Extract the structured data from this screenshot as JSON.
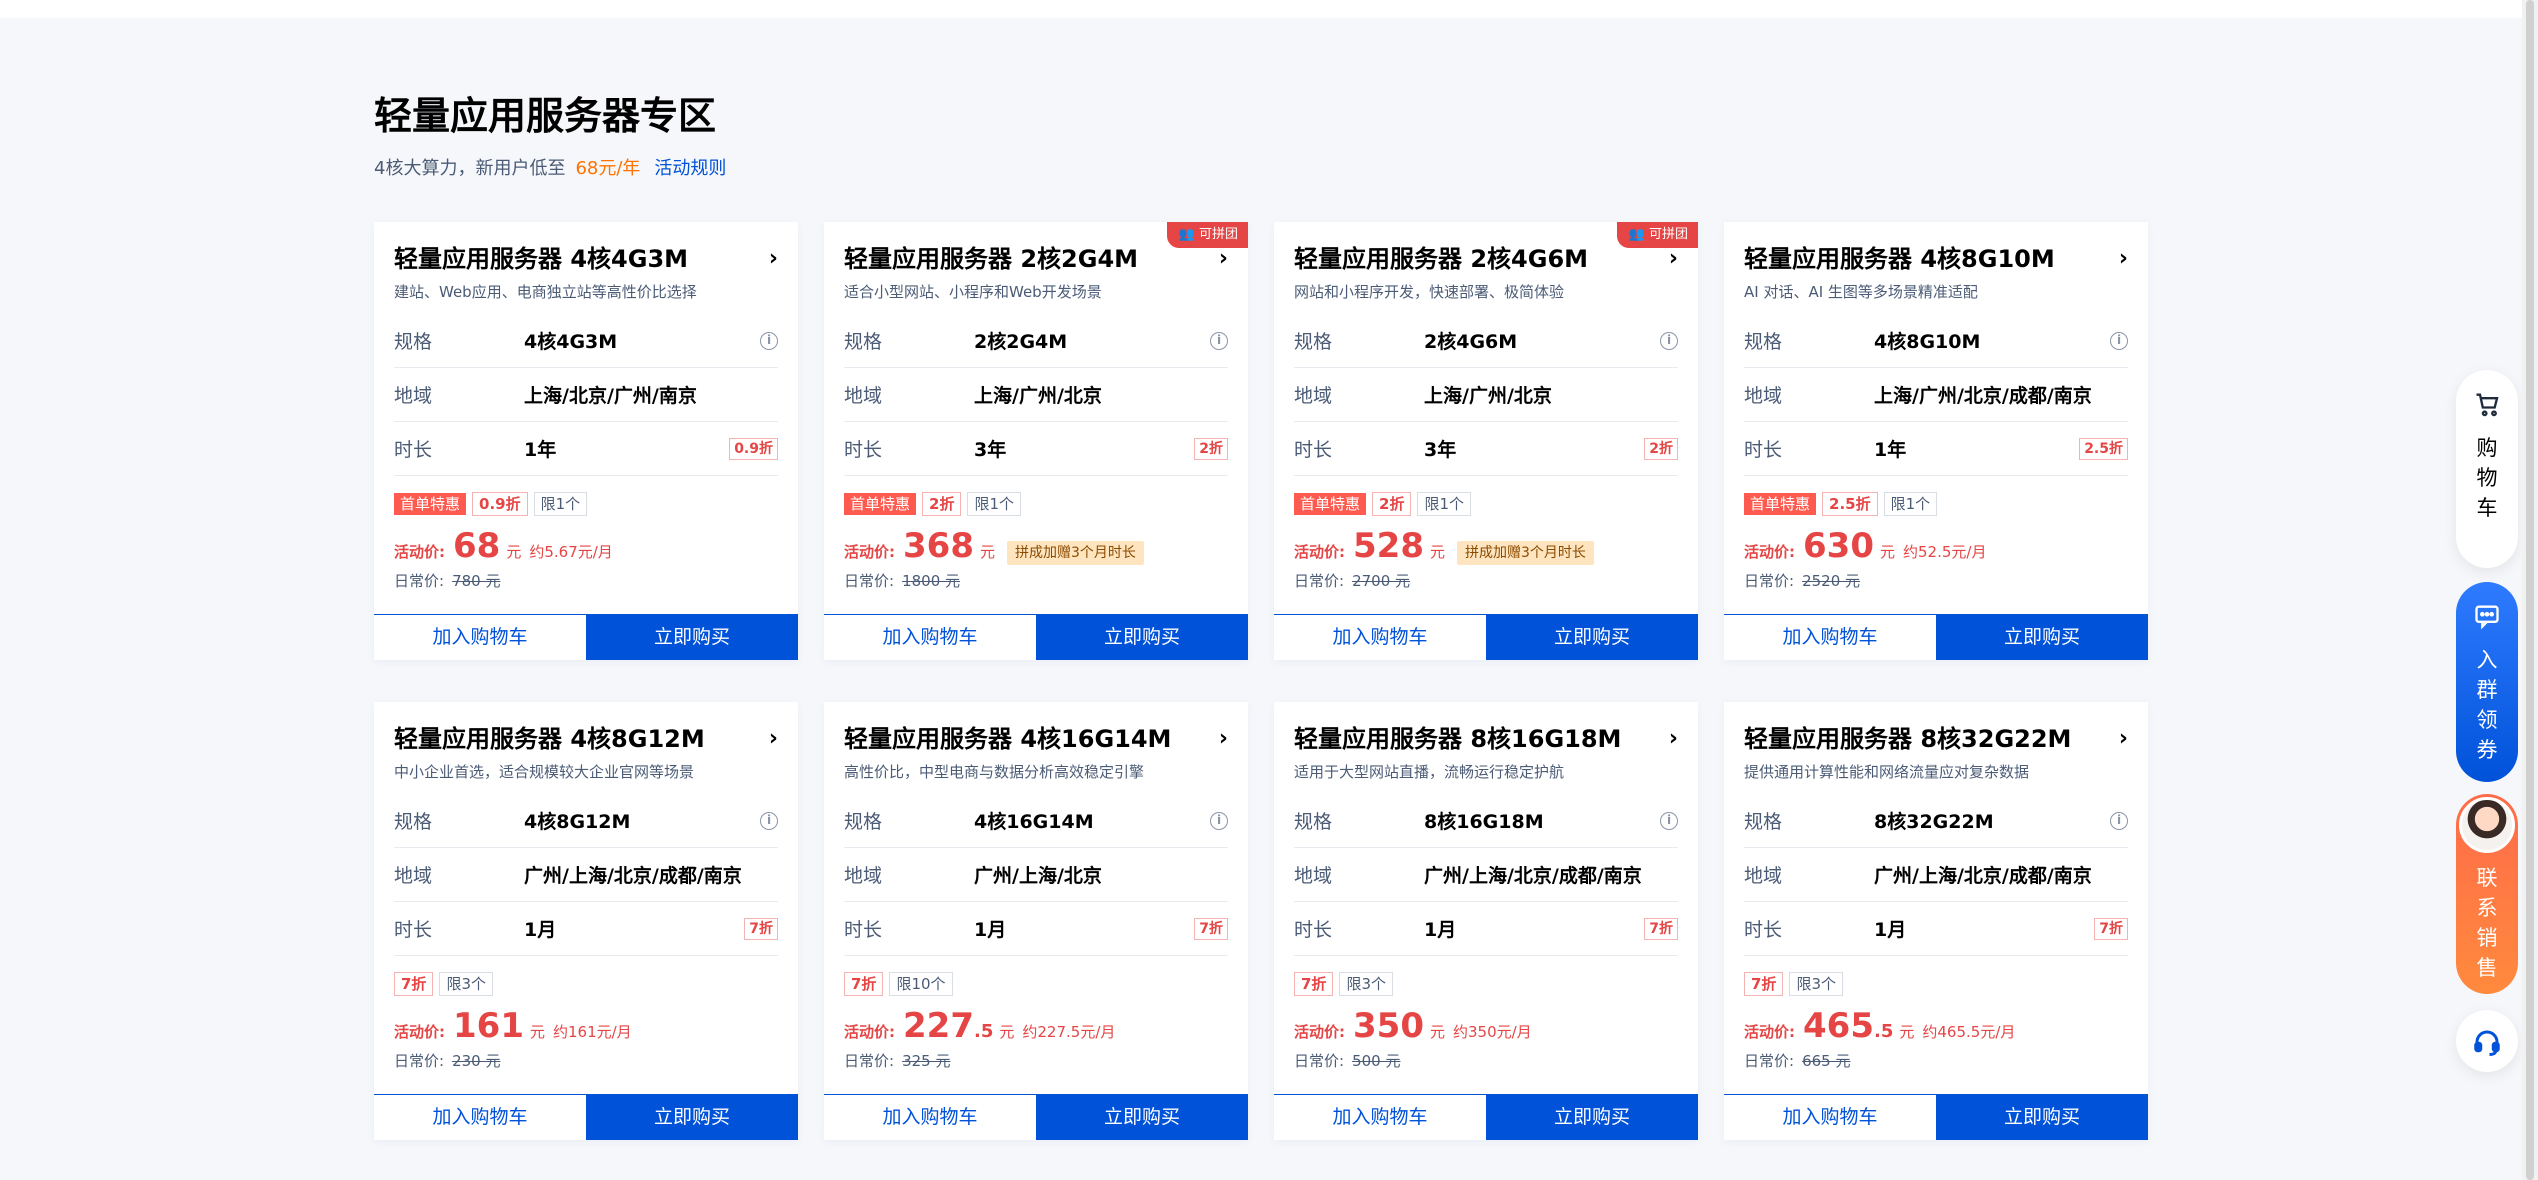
{
  "section": {
    "title": "轻量应用服务器专区",
    "subtitle": "4核大算力，新用户低至",
    "highlight": "68元/年",
    "rule_link": "活动规则"
  },
  "labels": {
    "spec": "规格",
    "region": "地域",
    "duration": "时长",
    "price_label": "活动价:",
    "orig_label": "日常价:",
    "yuan": "元",
    "add_cart": "加入购物车",
    "buy_now": "立即购买"
  },
  "cards": [
    {
      "title": "轻量应用服务器 4核4G3M",
      "desc": "建站、Web应用、电商独立站等高性价比选择",
      "spec": "4核4G3M",
      "region": "上海/北京/广州/南京",
      "duration": "1年",
      "discount": "0.9折",
      "badge": "",
      "special": "首单特惠",
      "tag_disc": "0.9折",
      "limit": "限1个",
      "price_int": "68",
      "price_dec": "",
      "approx": "约5.67元/月",
      "promo": "",
      "orig": "780 元"
    },
    {
      "title": "轻量应用服务器 2核2G4M",
      "desc": "适合小型网站、小程序和Web开发场景",
      "spec": "2核2G4M",
      "region": "上海/广州/北京",
      "duration": "3年",
      "discount": "2折",
      "badge": "可拼团",
      "special": "首单特惠",
      "tag_disc": "2折",
      "limit": "限1个",
      "price_int": "368",
      "price_dec": "",
      "approx": "",
      "promo": "拼成加赠3个月时长",
      "orig": "1800 元"
    },
    {
      "title": "轻量应用服务器 2核4G6M",
      "desc": "网站和小程序开发，快速部署、极简体验",
      "spec": "2核4G6M",
      "region": "上海/广州/北京",
      "duration": "3年",
      "discount": "2折",
      "badge": "可拼团",
      "special": "首单特惠",
      "tag_disc": "2折",
      "limit": "限1个",
      "price_int": "528",
      "price_dec": "",
      "approx": "",
      "promo": "拼成加赠3个月时长",
      "orig": "2700 元"
    },
    {
      "title": "轻量应用服务器 4核8G10M",
      "desc": "AI 对话、AI 生图等多场景精准适配",
      "spec": "4核8G10M",
      "region": "上海/广州/北京/成都/南京",
      "duration": "1年",
      "discount": "2.5折",
      "badge": "",
      "special": "首单特惠",
      "tag_disc": "2.5折",
      "limit": "限1个",
      "price_int": "630",
      "price_dec": "",
      "approx": "约52.5元/月",
      "promo": "",
      "orig": "2520 元"
    },
    {
      "title": "轻量应用服务器 4核8G12M",
      "desc": "中小企业首选，适合规模较大企业官网等场景",
      "spec": "4核8G12M",
      "region": "广州/上海/北京/成都/南京",
      "duration": "1月",
      "discount": "7折",
      "badge": "",
      "special": "",
      "tag_disc": "7折",
      "limit": "限3个",
      "price_int": "161",
      "price_dec": "",
      "approx": "约161元/月",
      "promo": "",
      "orig": "230 元"
    },
    {
      "title": "轻量应用服务器 4核16G14M",
      "desc": "高性价比，中型电商与数据分析高效稳定引擎",
      "spec": "4核16G14M",
      "region": "广州/上海/北京",
      "duration": "1月",
      "discount": "7折",
      "badge": "",
      "special": "",
      "tag_disc": "7折",
      "limit": "限10个",
      "price_int": "227",
      "price_dec": ".5",
      "approx": "约227.5元/月",
      "promo": "",
      "orig": "325 元"
    },
    {
      "title": "轻量应用服务器 8核16G18M",
      "desc": "适用于大型网站直播，流畅运行稳定护航",
      "spec": "8核16G18M",
      "region": "广州/上海/北京/成都/南京",
      "duration": "1月",
      "discount": "7折",
      "badge": "",
      "special": "",
      "tag_disc": "7折",
      "limit": "限3个",
      "price_int": "350",
      "price_dec": "",
      "approx": "约350元/月",
      "promo": "",
      "orig": "500 元"
    },
    {
      "title": "轻量应用服务器 8核32G22M",
      "desc": "提供通用计算性能和网络流量应对复杂数据",
      "spec": "8核32G22M",
      "region": "广州/上海/北京/成都/南京",
      "duration": "1月",
      "discount": "7折",
      "badge": "",
      "special": "",
      "tag_disc": "7折",
      "limit": "限3个",
      "price_int": "465",
      "price_dec": ".5",
      "approx": "约465.5元/月",
      "promo": "",
      "orig": "665 元"
    }
  ],
  "sidebar": {
    "cart": [
      "购",
      "物",
      "车"
    ],
    "group": [
      "入",
      "群",
      "领",
      "券"
    ],
    "sales": [
      "联",
      "系",
      "销",
      "售"
    ]
  },
  "icons": {
    "arrow": "chevron-right-icon",
    "info": "info-icon",
    "cart": "cart-icon",
    "chat": "chat-icon",
    "headset": "headset-icon"
  },
  "colors": {
    "primary": "#0052d9",
    "price": "#e54545",
    "highlight": "#ff7200"
  }
}
